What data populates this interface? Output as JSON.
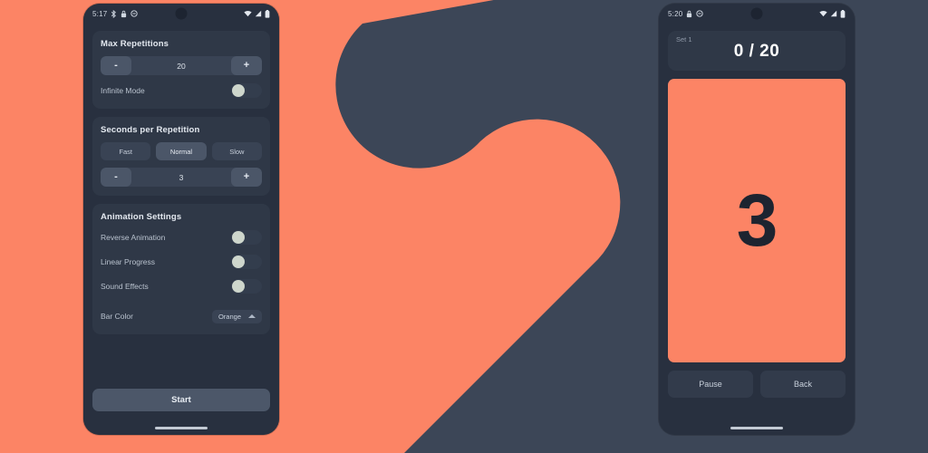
{
  "theme": {
    "accent_orange": "#FC8465",
    "background_navy": "#3C4657",
    "screen_background": "#28303F",
    "card_background": "#2F3847"
  },
  "background": {
    "artwork_name": "s-curve-logo-shape"
  },
  "left_phone": {
    "status_bar": {
      "time": "5:17",
      "icons_left": [
        "bluetooth-icon",
        "lock-icon",
        "dnd-icon"
      ],
      "icons_right": [
        "wifi-icon",
        "signal-icon",
        "battery-icon"
      ]
    },
    "sections": {
      "max_repetitions": {
        "title": "Max Repetitions",
        "stepper": {
          "decrement": "-",
          "value": "20",
          "increment": "+"
        },
        "infinite_mode": {
          "label": "Infinite Mode",
          "enabled": false
        }
      },
      "seconds_per_repetition": {
        "title": "Seconds per Repetition",
        "presets": [
          {
            "label": "Fast",
            "selected": false
          },
          {
            "label": "Normal",
            "selected": true
          },
          {
            "label": "Slow",
            "selected": false
          }
        ],
        "stepper": {
          "decrement": "-",
          "value": "3",
          "increment": "+"
        }
      },
      "animation_settings": {
        "title": "Animation Settings",
        "toggles": [
          {
            "label": "Reverse Animation",
            "enabled": false
          },
          {
            "label": "Linear Progress",
            "enabled": false
          },
          {
            "label": "Sound Effects",
            "enabled": false
          }
        ],
        "bar_color": {
          "label": "Bar Color",
          "value": "Orange"
        }
      }
    },
    "start_button": "Start"
  },
  "right_phone": {
    "status_bar": {
      "time": "5:20",
      "icons_left": [
        "lock-icon",
        "dnd-icon"
      ],
      "icons_right": [
        "wifi-icon",
        "signal-icon",
        "battery-icon"
      ]
    },
    "counter": {
      "set_label": "Set 1",
      "value": "0 / 20"
    },
    "timer": {
      "number": "3"
    },
    "buttons": {
      "pause": "Pause",
      "back": "Back"
    }
  }
}
